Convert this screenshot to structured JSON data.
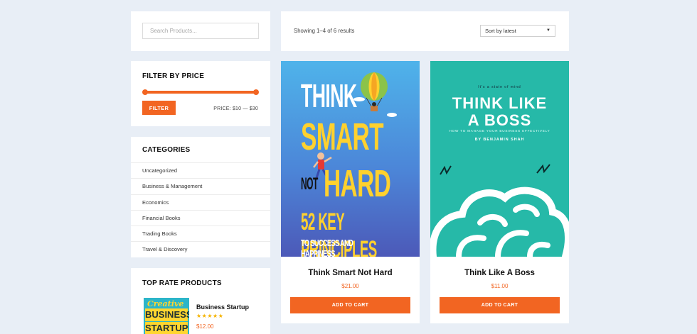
{
  "search": {
    "placeholder": "Search Products..."
  },
  "price_filter": {
    "title": "FILTER BY PRICE",
    "button_label": "FILTER",
    "range_text": "PRICE: $10 — $30",
    "min_value": 10,
    "max_value": 30
  },
  "categories": {
    "title": "CATEGORIES",
    "items": [
      "Uncategorized",
      "Business & Management",
      "Economics",
      "Financial Books",
      "Trading Books",
      "Travel & Discovery"
    ]
  },
  "top_rated": {
    "title": "TOP RATE PRODUCTS",
    "items": [
      {
        "name": "Business Startup",
        "rating": 5,
        "stars": "★★★★★",
        "price": "$12.00",
        "cover_lines": [
          "Creative",
          "BUSINESS",
          "STARTUP"
        ]
      }
    ]
  },
  "toolbar": {
    "result_count": "Showing 1–4 of 6 results",
    "sort_selected": "Sort by latest"
  },
  "products": [
    {
      "title": "Think Smart Not Hard",
      "price": "$21.00",
      "button_label": "ADD TO CART",
      "cover_text": {
        "line1": "THINK",
        "line2": "SMART",
        "line3a": "NOT",
        "line3b": "HARD",
        "line4": "52 KEY PRINCIPLES",
        "line5": "TO SUCCESS AND HAPPINESS"
      }
    },
    {
      "title": "Think Like A Boss",
      "price": "$11.00",
      "button_label": "ADD TO CART",
      "cover_text": {
        "top": "It's a state of mind",
        "line1": "THINK LIKE",
        "line2": "A BOSS",
        "tagline": "HOW TO MANAGE YOUR BUSINESS EFFECTIVELY",
        "author": "BY BENJAMIN SHAH"
      }
    }
  ],
  "colors": {
    "accent": "#f26522",
    "background": "#e8eef6",
    "star": "#f5b301"
  }
}
